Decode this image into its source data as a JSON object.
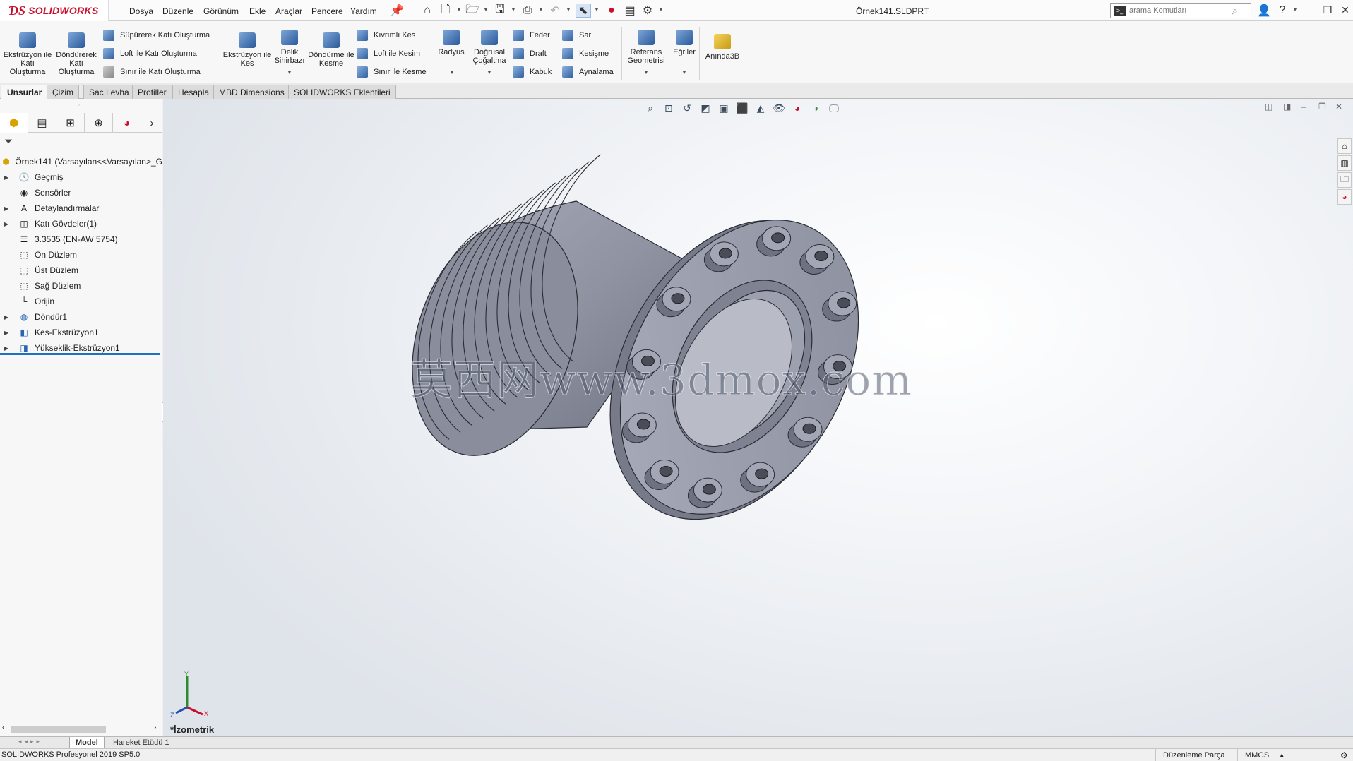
{
  "app": {
    "logo_text": "SOLIDWORKS",
    "document_title": "Örnek141.SLDPRT"
  },
  "menu": [
    "Dosya",
    "Düzenle",
    "Görünüm",
    "Ekle",
    "Araçlar",
    "Pencere",
    "Yardım"
  ],
  "search": {
    "placeholder": "arama Komutları"
  },
  "ribbon": {
    "extrude_boss": "Ekstrüzyon ile Katı Oluşturma",
    "revolve_boss": "Döndürerek Katı Oluşturma",
    "sweep_boss": "Süpürerek Katı Oluşturma",
    "loft_boss": "Loft ile Katı Oluşturma",
    "boundary_boss": "Sınır ile Katı Oluşturma",
    "extrude_cut": "Ekstrüzyon ile Kes",
    "hole_wizard": "Delik Sihirbazı",
    "revolve_cut": "Döndürme ile Kesme",
    "swept_cut": "Kıvrımlı Kes",
    "loft_cut": "Loft ile Kesim",
    "boundary_cut": "Sınır ile Kesme",
    "fillet": "Radyus",
    "linear_pattern": "Doğrusal Çoğaltma",
    "rib": "Feder",
    "draft": "Draft",
    "shell": "Kabuk",
    "wrap": "Sar",
    "intersect": "Kesişme",
    "mirror": "Aynalama",
    "ref_geometry": "Referans Geometrisi",
    "curves": "Eğriler",
    "instant3d": "Anında3B"
  },
  "tabs": [
    "Unsurlar",
    "Çizim",
    "Sac Levha",
    "Profiller",
    "Hesapla",
    "MBD Dimensions",
    "SOLIDWORKS Eklentileri"
  ],
  "tree": {
    "root": "Örnek141  (Varsayılan<<Varsayılan>_G",
    "items": [
      {
        "label": "Geçmiş",
        "expandable": true
      },
      {
        "label": "Sensörler",
        "expandable": false
      },
      {
        "label": "Detaylandırmalar",
        "expandable": true
      },
      {
        "label": "Katı Gövdeler(1)",
        "expandable": true
      },
      {
        "label": "3.3535 (EN-AW 5754)",
        "expandable": false
      },
      {
        "label": "Ön Düzlem",
        "expandable": false
      },
      {
        "label": "Üst Düzlem",
        "expandable": false
      },
      {
        "label": "Sağ Düzlem",
        "expandable": false
      },
      {
        "label": "Orijin",
        "expandable": false
      },
      {
        "label": "Döndür1",
        "expandable": true
      },
      {
        "label": "Kes-Ekstrüzyon1",
        "expandable": true
      },
      {
        "label": "Yükseklik-Ekstrüzyon1",
        "expandable": true
      }
    ]
  },
  "viewport": {
    "watermark": "莫西网www.3dmox.com",
    "view_name": "*İzometrik",
    "triad_labels": {
      "y": "Y",
      "x": "X",
      "z": "Z"
    }
  },
  "bottom_tabs": [
    "Model",
    "Hareket Etüdü 1"
  ],
  "status": {
    "product": "SOLIDWORKS Profesyonel 2019 SP5.0",
    "mode": "Düzenleme Parça",
    "units": "MMGS"
  },
  "colors": {
    "brand": "#c8102e",
    "part_gray": "#9a9eac",
    "selection_blue": "#1f72c1"
  }
}
